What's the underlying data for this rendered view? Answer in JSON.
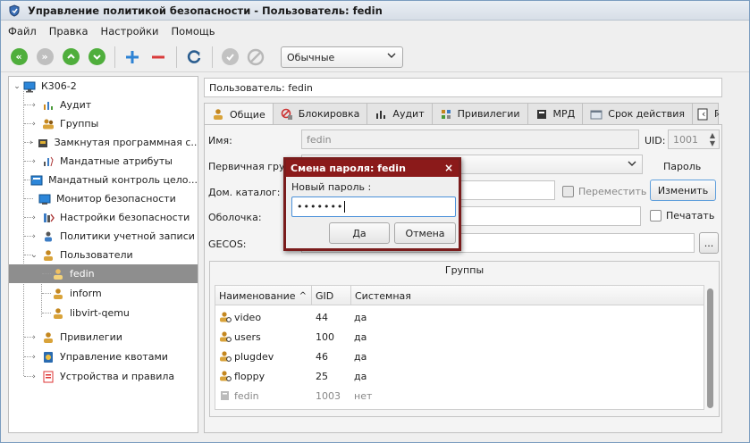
{
  "window": {
    "title": "Управление политикой безопасности - Пользователь: fedin"
  },
  "menu": [
    "Файл",
    "Правка",
    "Настройки",
    "Помощь"
  ],
  "toolbar": {
    "mode_select": "Обычные",
    "icons": [
      "first-icon",
      "last-icon",
      "up-icon",
      "down-icon",
      "add-icon",
      "remove-icon",
      "refresh-icon",
      "apply-icon",
      "cancel-icon"
    ]
  },
  "tree": {
    "root": "К306-2",
    "items": [
      {
        "label": "Аудит",
        "icon": "audit-icon"
      },
      {
        "label": "Группы",
        "icon": "groups-icon"
      },
      {
        "label": "Замкнутая программная с...",
        "icon": "closed-env-icon"
      },
      {
        "label": "Мандатные атрибуты",
        "icon": "mandatory-attr-icon"
      },
      {
        "label": "Мандатный контроль цело...",
        "icon": "integrity-icon"
      },
      {
        "label": "Монитор безопасности",
        "icon": "monitor-icon"
      },
      {
        "label": "Настройки безопасности",
        "icon": "security-settings-icon"
      },
      {
        "label": "Политики учетной записи",
        "icon": "account-policy-icon"
      },
      {
        "label": "Пользователи",
        "icon": "users-icon"
      },
      {
        "label": "fedin",
        "icon": "user-icon"
      },
      {
        "label": "inform",
        "icon": "user-icon"
      },
      {
        "label": "libvirt-qemu",
        "icon": "user-icon"
      },
      {
        "label": "Привилегии",
        "icon": "privileges-icon"
      },
      {
        "label": "Управление квотами",
        "icon": "quota-icon"
      },
      {
        "label": "Устройства и правила",
        "icon": "devices-icon"
      }
    ]
  },
  "user_header": "Пользователь: fedin",
  "tabs": [
    "Общие",
    "Блокировка",
    "Аудит",
    "Привилегии",
    "МРД",
    "Срок действия",
    "П"
  ],
  "form": {
    "name_label": "Имя:",
    "name_value": "fedin",
    "uid_label": "UID:",
    "uid_value": "1001",
    "primary_group_label": "Первичная группа:",
    "password_label": "Пароль",
    "home_label": "Дом. каталог:",
    "move_label": "Переместить",
    "change_button": "Изменить",
    "shell_label": "Оболочка:",
    "print_label": "Печатать",
    "gecos_label": "GECOS:",
    "gecos_button": "..."
  },
  "groups": {
    "title": "Группы",
    "columns": [
      "Наименование",
      "GID",
      "Системная"
    ],
    "rows": [
      {
        "name": "video",
        "gid": "44",
        "system": "да"
      },
      {
        "name": "users",
        "gid": "100",
        "system": "да"
      },
      {
        "name": "plugdev",
        "gid": "46",
        "system": "да"
      },
      {
        "name": "floppy",
        "gid": "25",
        "system": "да"
      },
      {
        "name": "fedin",
        "gid": "1003",
        "system": "нет"
      }
    ]
  },
  "dialog": {
    "title": "Смена пароля: fedin",
    "label": "Новый пароль :",
    "value": "•••••••",
    "ok": "Да",
    "cancel": "Отмена"
  }
}
